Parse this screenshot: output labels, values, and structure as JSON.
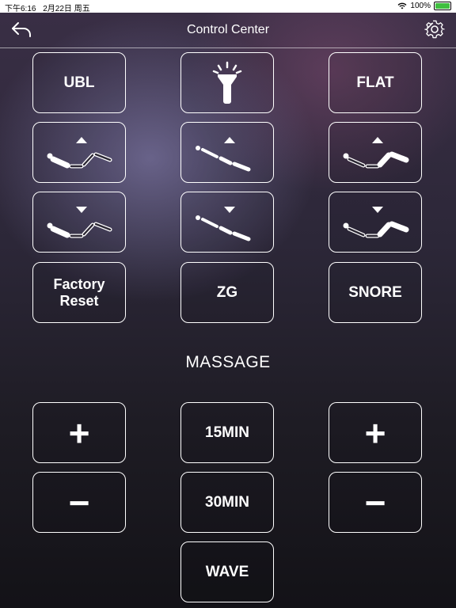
{
  "status_bar": {
    "time": "下午6:16",
    "date": "2月22日 周五",
    "battery": "100%",
    "icons": [
      "wifi-icon",
      "battery-icon"
    ]
  },
  "header": {
    "title": "Control Center",
    "icons": [
      "back-arrow-icon",
      "gear-icon"
    ]
  },
  "buttons": {
    "ubl": "UBL",
    "flashlight_icon": "flashlight-icon",
    "flat": "FLAT",
    "head_up_icon": "head-up-icon",
    "tilt_up_icon": "tilt-up-icon",
    "foot_up_icon": "foot-up-icon",
    "head_down_icon": "head-down-icon",
    "tilt_down_icon": "tilt-down-icon",
    "foot_down_icon": "foot-down-icon",
    "factory_reset": "Factory Reset",
    "zg": "ZG",
    "snore": "SNORE"
  },
  "massage": {
    "label": "MASSAGE",
    "left_plus": "+",
    "left_minus": "−",
    "min15": "15MIN",
    "min30": "30MIN",
    "wave": "WAVE",
    "right_plus": "+",
    "right_minus": "−"
  },
  "colors": {
    "button_border": "#ffffff",
    "text": "#ffffff",
    "background_top": "#3a2f46",
    "background_bottom": "#131217"
  }
}
